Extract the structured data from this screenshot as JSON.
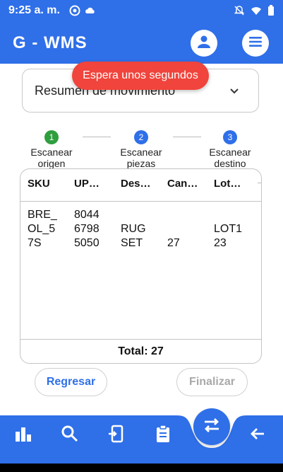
{
  "status_bar": {
    "time": "9:25 a. m."
  },
  "app": {
    "title": "G - WMS"
  },
  "summary": {
    "label": "Resumen de movimiento"
  },
  "toast": {
    "text": "Espera unos segundos"
  },
  "steps": [
    {
      "number": "1",
      "label": "Escanear\norigen",
      "color": "#2e9e3e"
    },
    {
      "number": "2",
      "label": "Escanear\npiezas",
      "color": "#2f6fe8"
    },
    {
      "number": "3",
      "label": "Escanear\ndestino",
      "color": "#2f6fe8"
    }
  ],
  "table": {
    "headers": [
      "SKU",
      "UP…",
      "Des…",
      "Can…",
      "Lot…"
    ],
    "rows": [
      {
        "sku": "BRE_\nOL_5\n7S",
        "upc": "8044\n6798\n5050",
        "desc": "\nRUG\nSET",
        "qty": "\n\n27",
        "lot": "\nLOT1\n23"
      }
    ],
    "total": "Total: 27"
  },
  "buttons": {
    "back": "Regresar",
    "finish": "Finalizar"
  },
  "colors": {
    "primary": "#2f6fe8",
    "toast": "#f0443c",
    "step_done": "#2e9e3e"
  },
  "nav": {
    "icons": [
      "chart-icon",
      "search-icon",
      "transfer-device-icon",
      "clipboard-icon",
      "swap-icon",
      "arrow-back-icon"
    ]
  }
}
